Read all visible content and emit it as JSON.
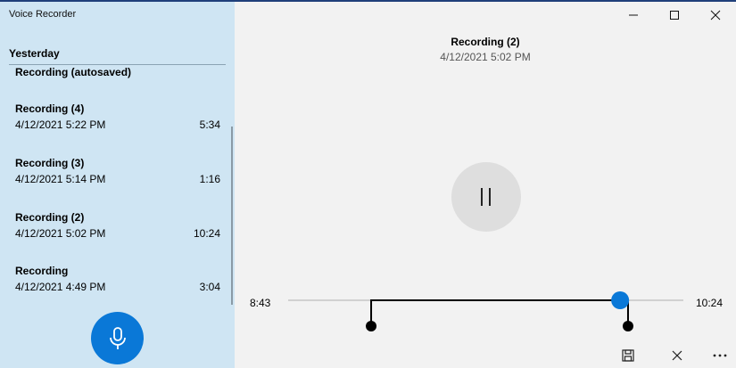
{
  "app": {
    "title": "Voice Recorder"
  },
  "sidebar": {
    "section_header": "Yesterday",
    "partial_item": "Recording (autosaved)",
    "recordings": [
      {
        "name": "Recording (4)",
        "date": "4/12/2021 5:22 PM",
        "duration": "5:34"
      },
      {
        "name": "Recording (3)",
        "date": "4/12/2021 5:14 PM",
        "duration": "1:16"
      },
      {
        "name": "Recording (2)",
        "date": "4/12/2021 5:02 PM",
        "duration": "10:24"
      },
      {
        "name": "Recording",
        "date": "4/12/2021 4:49 PM",
        "duration": "3:04"
      }
    ],
    "mic_icon": "microphone-icon"
  },
  "player": {
    "title": "Recording (2)",
    "subtitle": "4/12/2021 5:02 PM",
    "current_time": "8:43",
    "total_time": "10:24",
    "trim_start_fraction": 0.21,
    "trim_end_fraction": 0.86,
    "playhead_fraction": 0.84,
    "pause_icon": "pause-icon"
  },
  "toolbar": {
    "save_icon": "save-icon",
    "cancel_icon": "close-icon",
    "more_icon": "more-icon"
  },
  "colors": {
    "accent": "#0a78d7",
    "sidebar_bg": "#cfe5f3",
    "main_bg": "#f2f2f2"
  }
}
